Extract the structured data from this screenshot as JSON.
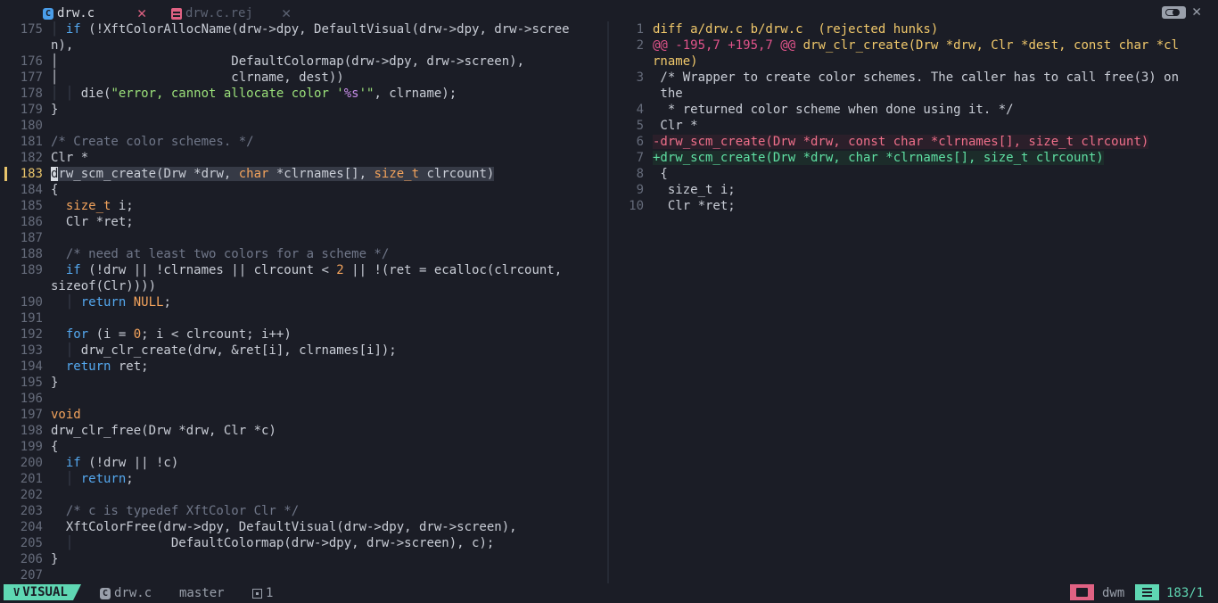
{
  "tabs": [
    {
      "name": "drw.c",
      "close": "✕"
    },
    {
      "name": "drw.c.rej",
      "close": "✕"
    }
  ],
  "tab_close": "✕",
  "colors": {
    "background": "#1b1d26",
    "mode_accent": "#5fd7b3",
    "cursor_line": "#e8c46b",
    "keyword": "#54a8ef",
    "type": "#f3a35c",
    "string": "#9be07a",
    "diff_delete": "#ef6f8a",
    "diff_add": "#5fe0a3"
  },
  "left_pane": {
    "current_line": "183",
    "lines": [
      {
        "n": "175",
        "segs": [
          [
            "│ ",
            "bl"
          ],
          [
            "if",
            "kw"
          ],
          [
            " (!XftColorAllocName(drw->dpy, DefaultVisual(drw->dpy, drw->scree",
            ""
          ]
        ]
      },
      {
        "n": "",
        "segs": [
          [
            "n),",
            ""
          ]
        ]
      },
      {
        "n": "176",
        "segs": [
          [
            "│                       DefaultColormap(drw->dpy, drw->screen),",
            ""
          ]
        ]
      },
      {
        "n": "177",
        "segs": [
          [
            "│                       clrname, dest))",
            ""
          ]
        ]
      },
      {
        "n": "178",
        "segs": [
          [
            "│ ",
            "bl"
          ],
          [
            "│ ",
            "bl"
          ],
          [
            "die(",
            ""
          ],
          [
            "\"error, cannot allocate color '",
            "str"
          ],
          [
            "%s",
            "fmt"
          ],
          [
            "'\"",
            "str"
          ],
          [
            ", clrname);",
            ""
          ]
        ]
      },
      {
        "n": "179",
        "segs": [
          [
            "}",
            ""
          ]
        ]
      },
      {
        "n": "180",
        "segs": []
      },
      {
        "n": "181",
        "segs": [
          [
            "/* Create color schemes. */",
            "cm"
          ]
        ]
      },
      {
        "n": "182",
        "segs": [
          [
            "Clr *",
            ""
          ]
        ]
      },
      {
        "n": "183",
        "segs": [
          [
            "d",
            "cursor"
          ],
          [
            "rw_scm_create(Drw *drw, ",
            "sel"
          ],
          [
            "char",
            "ty sel"
          ],
          [
            " *clrnames[], ",
            "sel"
          ],
          [
            "size_t",
            "ty sel"
          ],
          [
            " clrcount)",
            "sel"
          ]
        ]
      },
      {
        "n": "184",
        "segs": [
          [
            "{",
            ""
          ]
        ]
      },
      {
        "n": "185",
        "segs": [
          [
            "  ",
            ""
          ],
          [
            "size_t",
            "ty"
          ],
          [
            " i;",
            ""
          ]
        ]
      },
      {
        "n": "186",
        "segs": [
          [
            "  Clr *ret;",
            ""
          ]
        ]
      },
      {
        "n": "187",
        "segs": []
      },
      {
        "n": "188",
        "segs": [
          [
            "  ",
            ""
          ],
          [
            "/* need at least two colors for a scheme */",
            "cm"
          ]
        ]
      },
      {
        "n": "189",
        "segs": [
          [
            "  ",
            ""
          ],
          [
            "if",
            "kw"
          ],
          [
            " (!drw || !clrnames || clrcount < ",
            ""
          ],
          [
            "2",
            "num"
          ],
          [
            " || !(ret = ecalloc(clrcount,",
            ""
          ]
        ]
      },
      {
        "n": "",
        "segs": [
          [
            "sizeof(Clr))))",
            ""
          ]
        ]
      },
      {
        "n": "190",
        "segs": [
          [
            "  ",
            ""
          ],
          [
            "│ ",
            "bl"
          ],
          [
            "return",
            "kw"
          ],
          [
            " ",
            ""
          ],
          [
            "NULL",
            "ty"
          ],
          [
            ";",
            ""
          ]
        ]
      },
      {
        "n": "191",
        "segs": []
      },
      {
        "n": "192",
        "segs": [
          [
            "  ",
            ""
          ],
          [
            "for",
            "kw"
          ],
          [
            " (i = ",
            ""
          ],
          [
            "0",
            "num"
          ],
          [
            "; i < clrcount; i++)",
            ""
          ]
        ]
      },
      {
        "n": "193",
        "segs": [
          [
            "  ",
            ""
          ],
          [
            "│ ",
            "bl"
          ],
          [
            "drw_clr_create(drw, &ret[i], clrnames[i]);",
            ""
          ]
        ]
      },
      {
        "n": "194",
        "segs": [
          [
            "  ",
            ""
          ],
          [
            "return",
            "kw"
          ],
          [
            " ret;",
            ""
          ]
        ]
      },
      {
        "n": "195",
        "segs": [
          [
            "}",
            ""
          ]
        ]
      },
      {
        "n": "196",
        "segs": []
      },
      {
        "n": "197",
        "segs": [
          [
            "void",
            "ty"
          ]
        ]
      },
      {
        "n": "198",
        "segs": [
          [
            "drw_clr_free(Drw *drw, Clr *c)",
            ""
          ]
        ]
      },
      {
        "n": "199",
        "segs": [
          [
            "{",
            ""
          ]
        ]
      },
      {
        "n": "200",
        "segs": [
          [
            "  ",
            ""
          ],
          [
            "if",
            "kw"
          ],
          [
            " (!drw || !c)",
            ""
          ]
        ]
      },
      {
        "n": "201",
        "segs": [
          [
            "  ",
            ""
          ],
          [
            "│ ",
            "bl"
          ],
          [
            "return",
            "kw"
          ],
          [
            ";",
            ""
          ]
        ]
      },
      {
        "n": "202",
        "segs": []
      },
      {
        "n": "203",
        "segs": [
          [
            "  ",
            ""
          ],
          [
            "/* c is typedef XftColor Clr */",
            "cm"
          ]
        ]
      },
      {
        "n": "204",
        "segs": [
          [
            "  XftColorFree(drw->dpy, DefaultVisual(drw->dpy, drw->screen),",
            ""
          ]
        ]
      },
      {
        "n": "205",
        "segs": [
          [
            "  ",
            ""
          ],
          [
            "│             ",
            "bl"
          ],
          [
            "DefaultColormap(drw->dpy, drw->screen), c);",
            ""
          ]
        ]
      },
      {
        "n": "206",
        "segs": [
          [
            "}",
            ""
          ]
        ]
      },
      {
        "n": "207",
        "segs": []
      }
    ]
  },
  "right_pane": {
    "lines": [
      {
        "n": "1",
        "segs": [
          [
            "diff a/drw.c b/drw.c  (rejected hunks)",
            "hdr"
          ]
        ]
      },
      {
        "n": "2",
        "segs": [
          [
            "@@ -195,7 +195,7 @@",
            "hunk"
          ],
          [
            " drw_clr_create(Drw *drw, Clr *dest, const char *cl",
            "hunkt"
          ]
        ]
      },
      {
        "n": "",
        "segs": [
          [
            "rname)",
            "hunkt"
          ]
        ]
      },
      {
        "n": "3",
        "segs": [
          [
            " /* Wrapper to create color schemes. The caller has to call free(3) on",
            ""
          ]
        ]
      },
      {
        "n": "",
        "segs": [
          [
            " the",
            ""
          ]
        ]
      },
      {
        "n": "4",
        "segs": [
          [
            "  * returned color scheme when done using it. */",
            ""
          ]
        ]
      },
      {
        "n": "5",
        "segs": [
          [
            " Clr *",
            ""
          ]
        ]
      },
      {
        "n": "6",
        "segs": [
          [
            "-drw_scm_create(Drw *drw, const char *clrnames[], size_t clrcount)",
            "del"
          ]
        ]
      },
      {
        "n": "7",
        "segs": [
          [
            "+drw_scm_create(Drw *drw, char *clrnames[], size_t clrcount)",
            "add"
          ]
        ]
      },
      {
        "n": "8",
        "segs": [
          [
            " {",
            ""
          ]
        ]
      },
      {
        "n": "9",
        "segs": [
          [
            "  size_t i;",
            ""
          ]
        ]
      },
      {
        "n": "10",
        "segs": [
          [
            "  Clr *ret;",
            ""
          ]
        ]
      }
    ]
  },
  "statusline": {
    "mode_icon": "V",
    "mode": "VISUAL",
    "file": "drw.c",
    "branch_icon": "",
    "branch": "master",
    "diagnostics": "1",
    "project": "dwm",
    "position": "183/1"
  }
}
